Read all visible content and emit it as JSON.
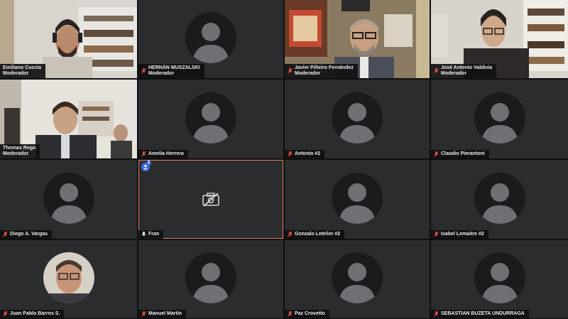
{
  "participants": [
    {
      "name": "Emiliano Cuccia",
      "role": "Moderador",
      "mic": "on"
    },
    {
      "name": "HERNÁN MUSZALSKI",
      "role": "Moderador",
      "mic": "off"
    },
    {
      "name": "Javier Piñeiro Fernández",
      "role": "Moderador",
      "mic": "off"
    },
    {
      "name": "José Antonio Valdivia",
      "role": "Moderador",
      "mic": "off"
    },
    {
      "name": "Thomas Rego",
      "role": "Moderador",
      "mic": "on"
    },
    {
      "name": "Amelia Herrera",
      "role": "",
      "mic": "off"
    },
    {
      "name": "Antonio #2",
      "role": "",
      "mic": "off"
    },
    {
      "name": "Claudio Pierantoni",
      "role": "",
      "mic": "off"
    },
    {
      "name": "Diego A. Vargas",
      "role": "",
      "mic": "off"
    },
    {
      "name": "Fran",
      "role": "",
      "mic": "on"
    },
    {
      "name": "Gonzalo Letelier #2",
      "role": "",
      "mic": "off"
    },
    {
      "name": "Isabel Lemaitre #2",
      "role": "",
      "mic": "off"
    },
    {
      "name": "Juan Pablo Barros S.",
      "role": "",
      "mic": "off"
    },
    {
      "name": "Manuel Martín",
      "role": "",
      "mic": "off"
    },
    {
      "name": "Paz Crovetto",
      "role": "",
      "mic": "off"
    },
    {
      "name": "SEBASTIAN BUZETA UNDURRAGA",
      "role": "",
      "mic": "off"
    }
  ],
  "fran_tile": {
    "badge_count": "1"
  },
  "colors": {
    "muted": "#e0503c",
    "accent": "#e0806a",
    "badge": "#3b6de0"
  }
}
